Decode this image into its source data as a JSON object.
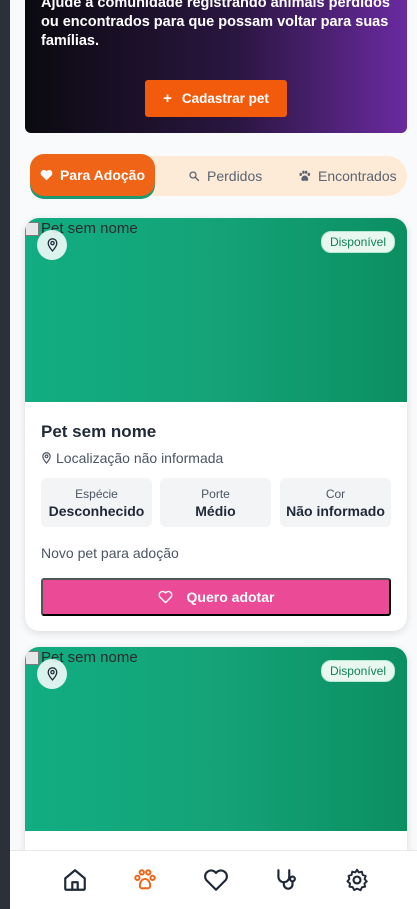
{
  "hero": {
    "text": "Ajude a comunidade registrando animais perdidos ou encontrados para que possam voltar para suas famílias.",
    "cta_label": "Cadastrar pet",
    "cta_icon": "plus-icon"
  },
  "tabs": [
    {
      "label": "Para Adoção",
      "icon": "heart-icon",
      "active": true
    },
    {
      "label": "Perdidos",
      "icon": "search-icon",
      "active": false
    },
    {
      "label": "Encontrados",
      "icon": "paw-icon",
      "active": false
    }
  ],
  "cards": [
    {
      "image_alt": "Pet sem nome",
      "status": "Disponível",
      "name": "Pet sem nome",
      "location": "Localização não informada",
      "attributes": [
        {
          "label": "Espécie",
          "value": "Desconhecido"
        },
        {
          "label": "Porte",
          "value": "Médio"
        },
        {
          "label": "Cor",
          "value": "Não informado"
        }
      ],
      "description": "Novo pet para adoção",
      "adopt_label": "Quero adotar"
    },
    {
      "image_alt": "Pet sem nome",
      "status": "Disponível"
    }
  ],
  "nav": [
    {
      "icon": "home-icon",
      "active": false
    },
    {
      "icon": "paw-icon",
      "active": true
    },
    {
      "icon": "heart-icon",
      "active": false
    },
    {
      "icon": "stethoscope-icon",
      "active": false
    },
    {
      "icon": "gear-icon",
      "active": false
    }
  ],
  "colors": {
    "accent": "#f25a0c",
    "adopt": "#ea4a96",
    "green": "#12ad82",
    "nav_active": "#f06418",
    "nav_inactive": "#1f2937"
  }
}
